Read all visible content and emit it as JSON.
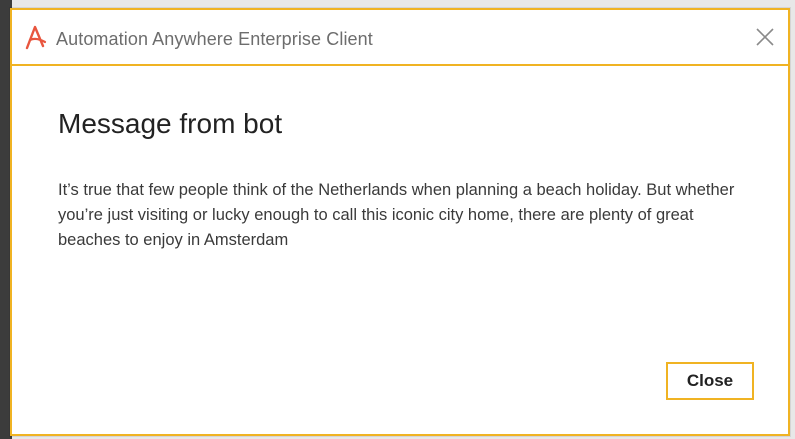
{
  "window": {
    "title": "Automation Anywhere Enterprise Client",
    "logo_icon": "automation-anywhere-logo",
    "close_icon": "close-icon",
    "accent_color": "#f0b323"
  },
  "message": {
    "heading": "Message from bot",
    "body": "It’s true that few people think of the Netherlands when planning a beach holiday. But whether you’re just visiting or lucky enough to call this iconic city home, there are plenty of great beaches to enjoy in Amsterdam"
  },
  "actions": {
    "close_label": "Close"
  }
}
